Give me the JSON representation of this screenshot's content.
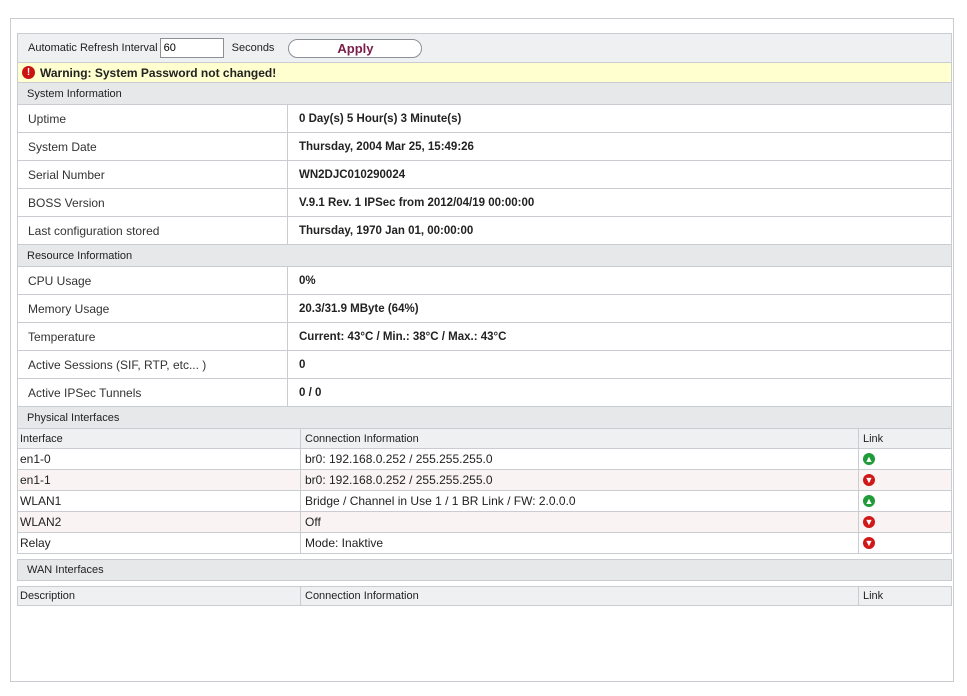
{
  "refresh": {
    "label": "Automatic Refresh Interval",
    "value": "60",
    "unit": "Seconds",
    "apply_label": "Apply"
  },
  "warning": {
    "text": "Warning: System Password not changed!",
    "icon": "exclamation-icon"
  },
  "system_information": {
    "title": "System Information",
    "rows": [
      {
        "label": "Uptime",
        "value": "0  Day(s)  5  Hour(s)  3  Minute(s)"
      },
      {
        "label": "System Date",
        "value": "Thursday, 2004 Mar 25, 15:49:26"
      },
      {
        "label": "Serial Number",
        "value": "WN2DJC010290024"
      },
      {
        "label": "BOSS Version",
        "value": "V.9.1 Rev. 1 IPSec from 2012/04/19 00:00:00"
      },
      {
        "label": "Last configuration stored",
        "value": "Thursday, 1970 Jan 01, 00:00:00"
      }
    ]
  },
  "resource_information": {
    "title": "Resource Information",
    "rows": [
      {
        "label": "CPU Usage",
        "value": "0%"
      },
      {
        "label": "Memory Usage",
        "value": "20.3/31.9 MByte (64%)"
      },
      {
        "label": "Temperature",
        "value": "Current:  43°C /  Min.:  38°C /  Max.:  43°C"
      },
      {
        "label": "Active Sessions (SIF, RTP, etc... )",
        "value": "0"
      },
      {
        "label": "Active IPSec Tunnels",
        "value": "0 / 0"
      }
    ]
  },
  "physical_interfaces": {
    "title": "Physical Interfaces",
    "columns": [
      "Interface",
      "Connection Information",
      "Link"
    ],
    "rows": [
      {
        "interface": "en1-0",
        "info": "br0:  192.168.0.252 / 255.255.255.0",
        "link": "up"
      },
      {
        "interface": "en1-1",
        "info": "br0:  192.168.0.252 / 255.255.255.0",
        "link": "down"
      },
      {
        "interface": "WLAN1",
        "info": "Bridge /  Channel in Use   1 /  1   BR Link /  FW:  2.0.0.0",
        "link": "up"
      },
      {
        "interface": "WLAN2",
        "info": "Off",
        "link": "down"
      },
      {
        "interface": "Relay",
        "info": "Mode:  Inaktive",
        "link": "down"
      }
    ]
  },
  "wan_interfaces": {
    "title": "WAN Interfaces",
    "columns": [
      "Description",
      "Connection Information",
      "Link"
    ]
  },
  "colors": {
    "link_up": "#1f9b3a",
    "link_down": "#d01818",
    "apply_text": "#7b1d4a",
    "warning_bg": "#ffffcf"
  }
}
